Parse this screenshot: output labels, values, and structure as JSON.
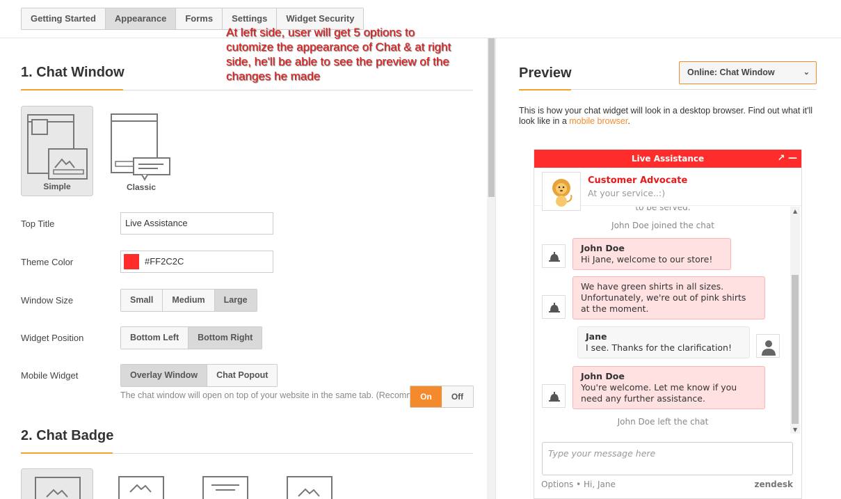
{
  "tabs": [
    "Getting Started",
    "Appearance",
    "Forms",
    "Settings",
    "Widget Security"
  ],
  "active_tab": "Appearance",
  "annotation": "At left side, user will get 5 options to cutomize the appearance of Chat & at right side, he'll be able to see the preview of the changes he made",
  "chat_window": {
    "title": "1. Chat Window",
    "layouts": [
      {
        "label": "Simple",
        "selected": true
      },
      {
        "label": "Classic",
        "selected": false
      }
    ],
    "top_title": {
      "label": "Top Title",
      "value": "Live Assistance"
    },
    "theme_color": {
      "label": "Theme Color",
      "value": "#FF2C2C"
    },
    "window_size": {
      "label": "Window Size",
      "options": [
        "Small",
        "Medium",
        "Large"
      ],
      "selected": "Large"
    },
    "widget_position": {
      "label": "Widget Position",
      "options": [
        "Bottom Left",
        "Bottom Right"
      ],
      "selected": "Bottom Right"
    },
    "mobile_widget": {
      "label": "Mobile Widget",
      "options": [
        "Overlay Window",
        "Chat Popout"
      ],
      "selected": "Overlay Window",
      "hint": "The chat window will open on top of your website in the same tab. (Recommended)"
    }
  },
  "chat_badge": {
    "title": "2. Chat Badge",
    "toggle": {
      "on": "On",
      "off": "Off",
      "selected": "On"
    }
  },
  "preview": {
    "title": "Preview",
    "select_value": "Online: Chat Window",
    "desc_text": "This is how your chat widget will look in a desktop browser. Find out what it'll look like in a ",
    "desc_link": "mobile browser",
    "desc_end": "."
  },
  "widget": {
    "header_title": "Live Assistance",
    "header_icons": "↗ —",
    "agent_name": "Customer Advocate",
    "agent_sub": "At your service..:)",
    "sys_top": "to be served.",
    "sys_join": "John Doe joined the chat",
    "messages": [
      {
        "who": "John Doe",
        "text": "Hi Jane, welcome to our store!"
      },
      {
        "who": "",
        "text": "We have green shirts in all sizes. Unfortunately, we're out of pink shirts at the moment."
      },
      {
        "who": "Jane",
        "text": "I see. Thanks for the clarification!"
      },
      {
        "who": "John Doe",
        "text": "You're welcome. Let me know if you need any further assistance."
      }
    ],
    "sys_left": "John Doe left the chat",
    "placeholder": "Type your message here",
    "footer_left": "Options • Hi, Jane",
    "brand": "zendesk"
  },
  "colors": {
    "theme": "#FF2C2C",
    "accent": "#F58A2C",
    "underline": "#F1A428"
  }
}
